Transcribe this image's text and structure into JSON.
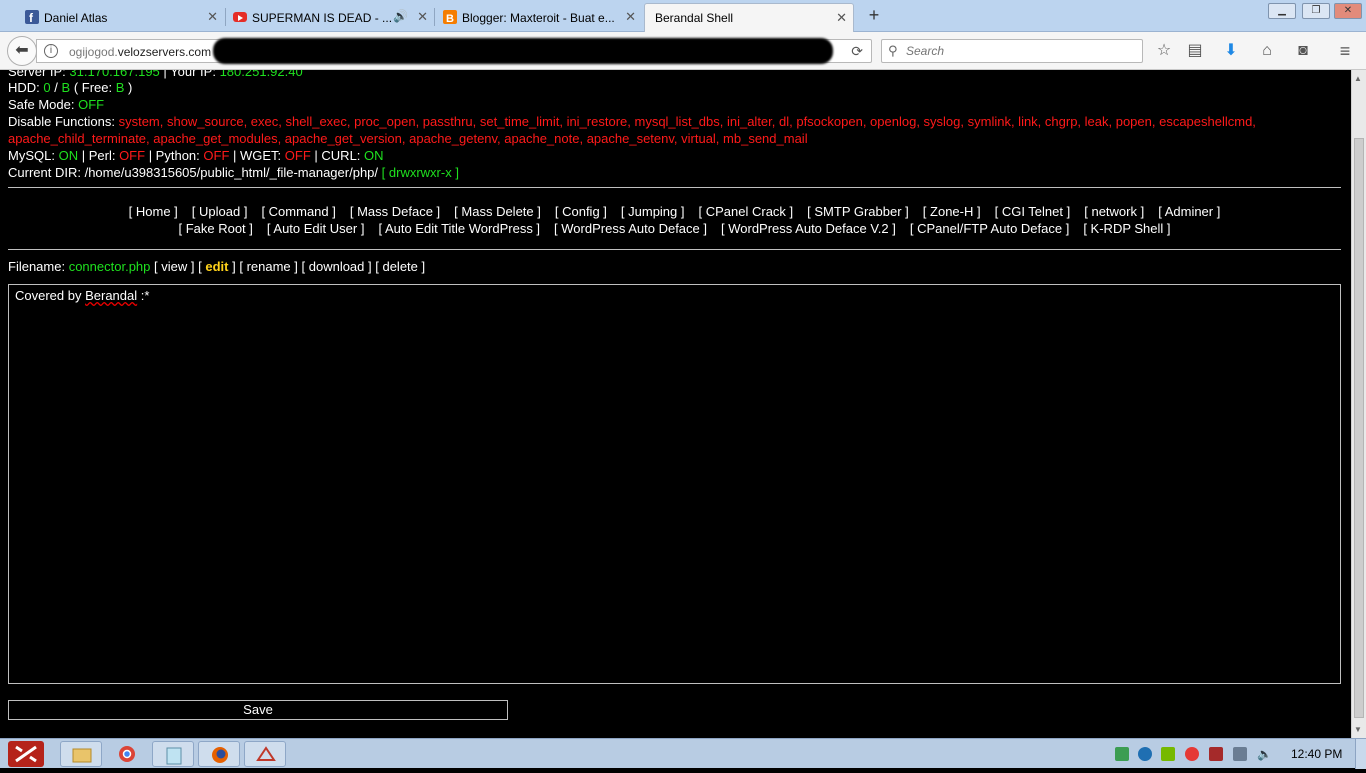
{
  "browser": {
    "tabs": [
      {
        "label": "Daniel Atlas",
        "icon": "facebook-icon"
      },
      {
        "label": "SUPERMAN IS DEAD - ...",
        "icon": "youtube-icon",
        "audio": true
      },
      {
        "label": "Blogger: Maxteroit - Buat e...",
        "icon": "blogger-icon"
      },
      {
        "label": "Berandal Shell",
        "icon": "none",
        "active": true
      }
    ],
    "url_prefix": "ogijogod.",
    "url_domain": "velozservers.com",
    "search_placeholder": "Search"
  },
  "colors": {
    "green": "#1fe01f",
    "red": "#ff1a1a",
    "yellow": "#ffd21a"
  },
  "shell": {
    "server_line": {
      "server_label": "Server IP:",
      "server_ip": "31.170.167.195",
      "sep": " | ",
      "your_label": "Your IP:",
      "your_ip": "180.251.92.40"
    },
    "hdd": {
      "label": "HDD:",
      "total": "0",
      "sep": "/",
      "used": "B",
      "free_label": "( Free:",
      "free": "B",
      "close": ")"
    },
    "safe_mode": {
      "label": "Safe Mode:",
      "value": "OFF"
    },
    "disable_functions": {
      "label": "Disable Functions:",
      "line1": "system, show_source, exec, shell_exec, proc_open, passthru, set_time_limit, ini_restore, mysql_list_dbs, ini_alter, dl, pfsockopen, openlog, syslog, symlink, link, chgrp, leak, popen, escapeshellcmd,",
      "line2": "apache_child_terminate, apache_get_modules, apache_get_version, apache_getenv, apache_note, apache_setenv, virtual, mb_send_mail"
    },
    "modules": {
      "mysql_label": "MySQL:",
      "mysql": "ON",
      "perl_label": "| Perl:",
      "perl": "OFF",
      "python_label": "| Python:",
      "python": "OFF",
      "wget_label": "| WGET:",
      "wget": "OFF",
      "curl_label": "| CURL:",
      "curl": "ON"
    },
    "current_dir": {
      "label": "Current DIR:",
      "path": "/home/u398315605/public_html/_file-manager/php/",
      "perm_open": "[",
      "perms": "drwxrwxr-x",
      "perm_close": "]"
    },
    "menu_row1": [
      "[ Home ]",
      "[ Upload ]",
      "[ Command ]",
      "[ Mass Deface ]",
      "[ Mass Delete ]",
      "[ Config ]",
      "[ Jumping ]",
      "[ CPanel Crack ]",
      "[ SMTP Grabber ]",
      "[ Zone-H ]",
      "[ CGI Telnet ]",
      "[ network ]",
      "[ Adminer ]"
    ],
    "menu_row2": [
      "[ Fake Root ]",
      "[ Auto Edit User ]",
      "[ Auto Edit Title WordPress ]",
      "[ WordPress Auto Deface ]",
      "[ WordPress Auto Deface V.2 ]",
      "[ CPanel/FTP Auto Deface ]",
      "[ K-RDP Shell ]"
    ],
    "file": {
      "label": "Filename:",
      "name": "connector.php",
      "actions": {
        "view": "[ view ]",
        "edit_open": "[",
        "edit": "edit",
        "edit_close": "]",
        "rename": "[ rename ]",
        "download": "[ download ]",
        "delete": "[ delete ]"
      }
    },
    "editor": {
      "text_before": "Covered by ",
      "text_squiggle": "Berandal",
      "text_after": " :*"
    },
    "save_label": "Save"
  },
  "taskbar": {
    "icons": [
      "dota2-icon",
      "file-explorer-icon",
      "chrome-icon",
      "notepad-icon",
      "firefox-icon",
      "app-icon"
    ],
    "clock": "12:40 PM"
  }
}
